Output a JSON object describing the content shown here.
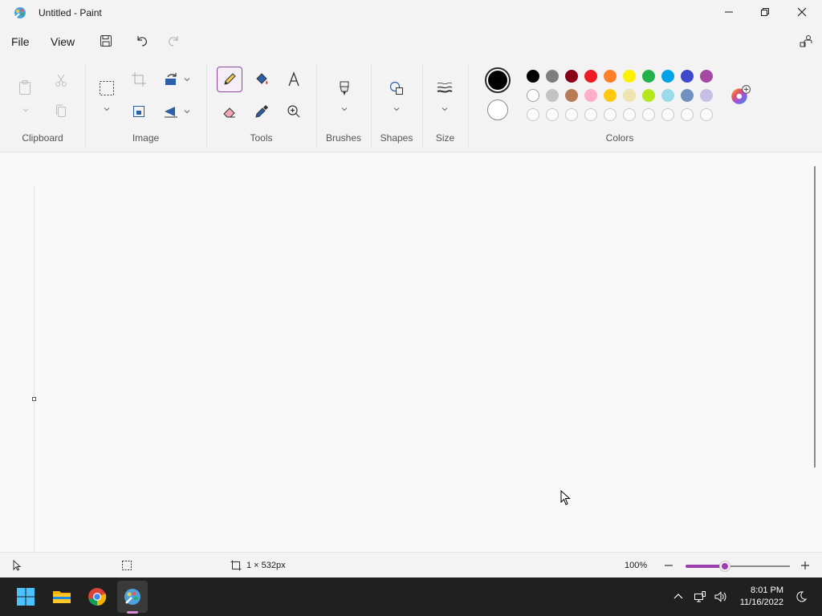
{
  "window": {
    "title": "Untitled - Paint"
  },
  "menu": {
    "file": "File",
    "view": "View"
  },
  "groups": {
    "clipboard": "Clipboard",
    "image": "Image",
    "tools": "Tools",
    "brushes": "Brushes",
    "shapes": "Shapes",
    "size": "Size",
    "colors": "Colors"
  },
  "palette": {
    "color1": "#000000",
    "color2": "#ffffff",
    "row1": [
      "#000000",
      "#7f7f7f",
      "#880015",
      "#ed1c24",
      "#ff7f27",
      "#fff200",
      "#22b14c",
      "#00a2e8",
      "#3f48cc",
      "#a349a4"
    ],
    "row2": [
      "#ffffff",
      "#c3c3c3",
      "#b97a57",
      "#ffaec9",
      "#ffc90e",
      "#efe4b0",
      "#b5e61d",
      "#99d9ea",
      "#7092be",
      "#c8bfe7"
    ]
  },
  "status": {
    "canvas_size": "1 × 532px",
    "zoom": "100%",
    "zoom_fraction": 0.38
  },
  "taskbar": {
    "time": "8:01 PM",
    "date": "11/16/2022"
  },
  "accent": "#9b3fb0"
}
